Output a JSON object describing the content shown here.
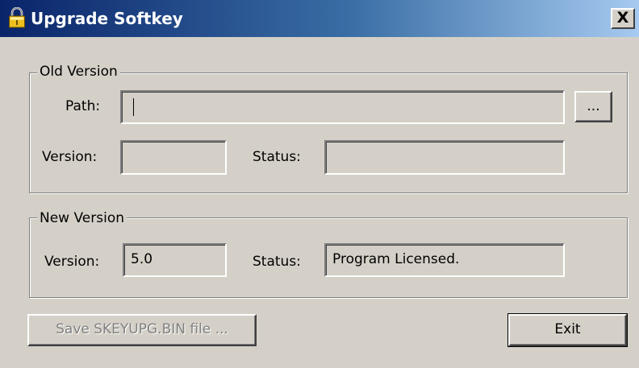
{
  "window": {
    "title": "Upgrade Softkey",
    "close_label": "X",
    "icon": "lock-icon"
  },
  "old_version": {
    "group_label": "Old Version",
    "path_label": "Path:",
    "path_value": "",
    "browse_label": "...",
    "version_label": "Version:",
    "version_value": "",
    "status_label": "Status:",
    "status_value": ""
  },
  "new_version": {
    "group_label": "New Version",
    "version_label": "Version:",
    "version_value": "5.0",
    "status_label": "Status:",
    "status_value": "Program Licensed."
  },
  "buttons": {
    "save_label": "Save SKEYUPG.BIN file ...",
    "save_enabled": false,
    "exit_label": "Exit"
  },
  "colors": {
    "titlebar_start": "#0a246a",
    "titlebar_end": "#a6caf0",
    "face": "#d4d0c8",
    "disabled_text": "#808080"
  }
}
